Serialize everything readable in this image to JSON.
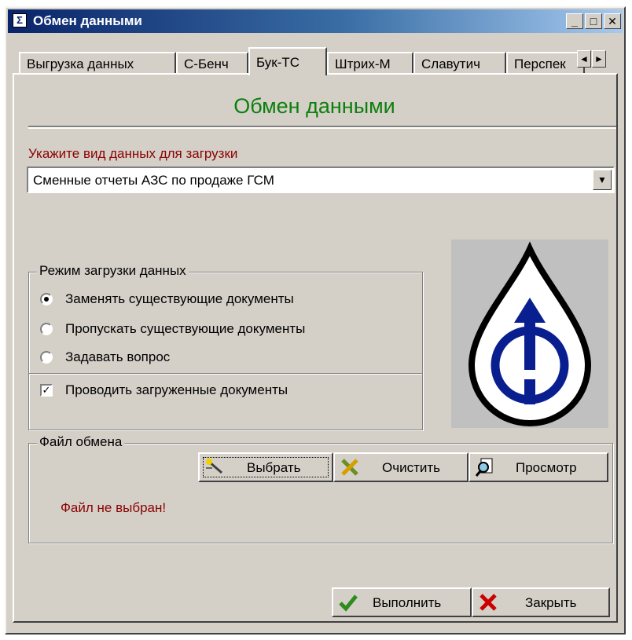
{
  "window": {
    "title": "Обмен данными",
    "controls": {
      "minimize": "_",
      "maximize": "□",
      "close": "✕"
    }
  },
  "tabs": [
    {
      "label": "Выгрузка данных",
      "active": false
    },
    {
      "label": "С-Бенч",
      "active": false
    },
    {
      "label": "Бук-ТС",
      "active": true
    },
    {
      "label": "Штрих-М",
      "active": false
    },
    {
      "label": "Славутич",
      "active": false
    },
    {
      "label": "Перспек",
      "active": false
    }
  ],
  "tab_scroll": {
    "left": "◄",
    "right": "►"
  },
  "main": {
    "heading": "Обмен данными",
    "data_type_label": "Укажите вид данных для загрузки",
    "data_type_value": "Сменные отчеты АЗС по продаже ГСМ",
    "combo_arrow": "▼"
  },
  "load_mode": {
    "title": "Режим загрузки данных",
    "options": [
      {
        "label": "Заменять существующие документы",
        "checked": true
      },
      {
        "label": "Пропускать существующие документы",
        "checked": false
      },
      {
        "label": "Задавать вопрос",
        "checked": false
      }
    ],
    "post_docs": {
      "label": "Проводить загруженные документы",
      "checked": true,
      "mark": "✓"
    }
  },
  "exchange_file": {
    "title": "Файл обмена",
    "buttons": {
      "choose": "Выбрать",
      "clear": "Очистить",
      "view": "Просмотр"
    },
    "status": "Файл не выбран!"
  },
  "footer": {
    "execute": "Выполнить",
    "close": "Закрыть"
  },
  "colors": {
    "heading": "#0e7f0e",
    "label": "#8b0000",
    "title_bar": "#0a246a",
    "logo_blue": "#0a1f8f",
    "check_green": "#2e8b1e",
    "close_red": "#cc0000"
  },
  "icons": {
    "app": "sigma-icon",
    "choose": "magic-wand-icon",
    "clear": "cross-icon",
    "view": "magnifier-icon",
    "execute": "check-icon",
    "close": "close-icon"
  }
}
